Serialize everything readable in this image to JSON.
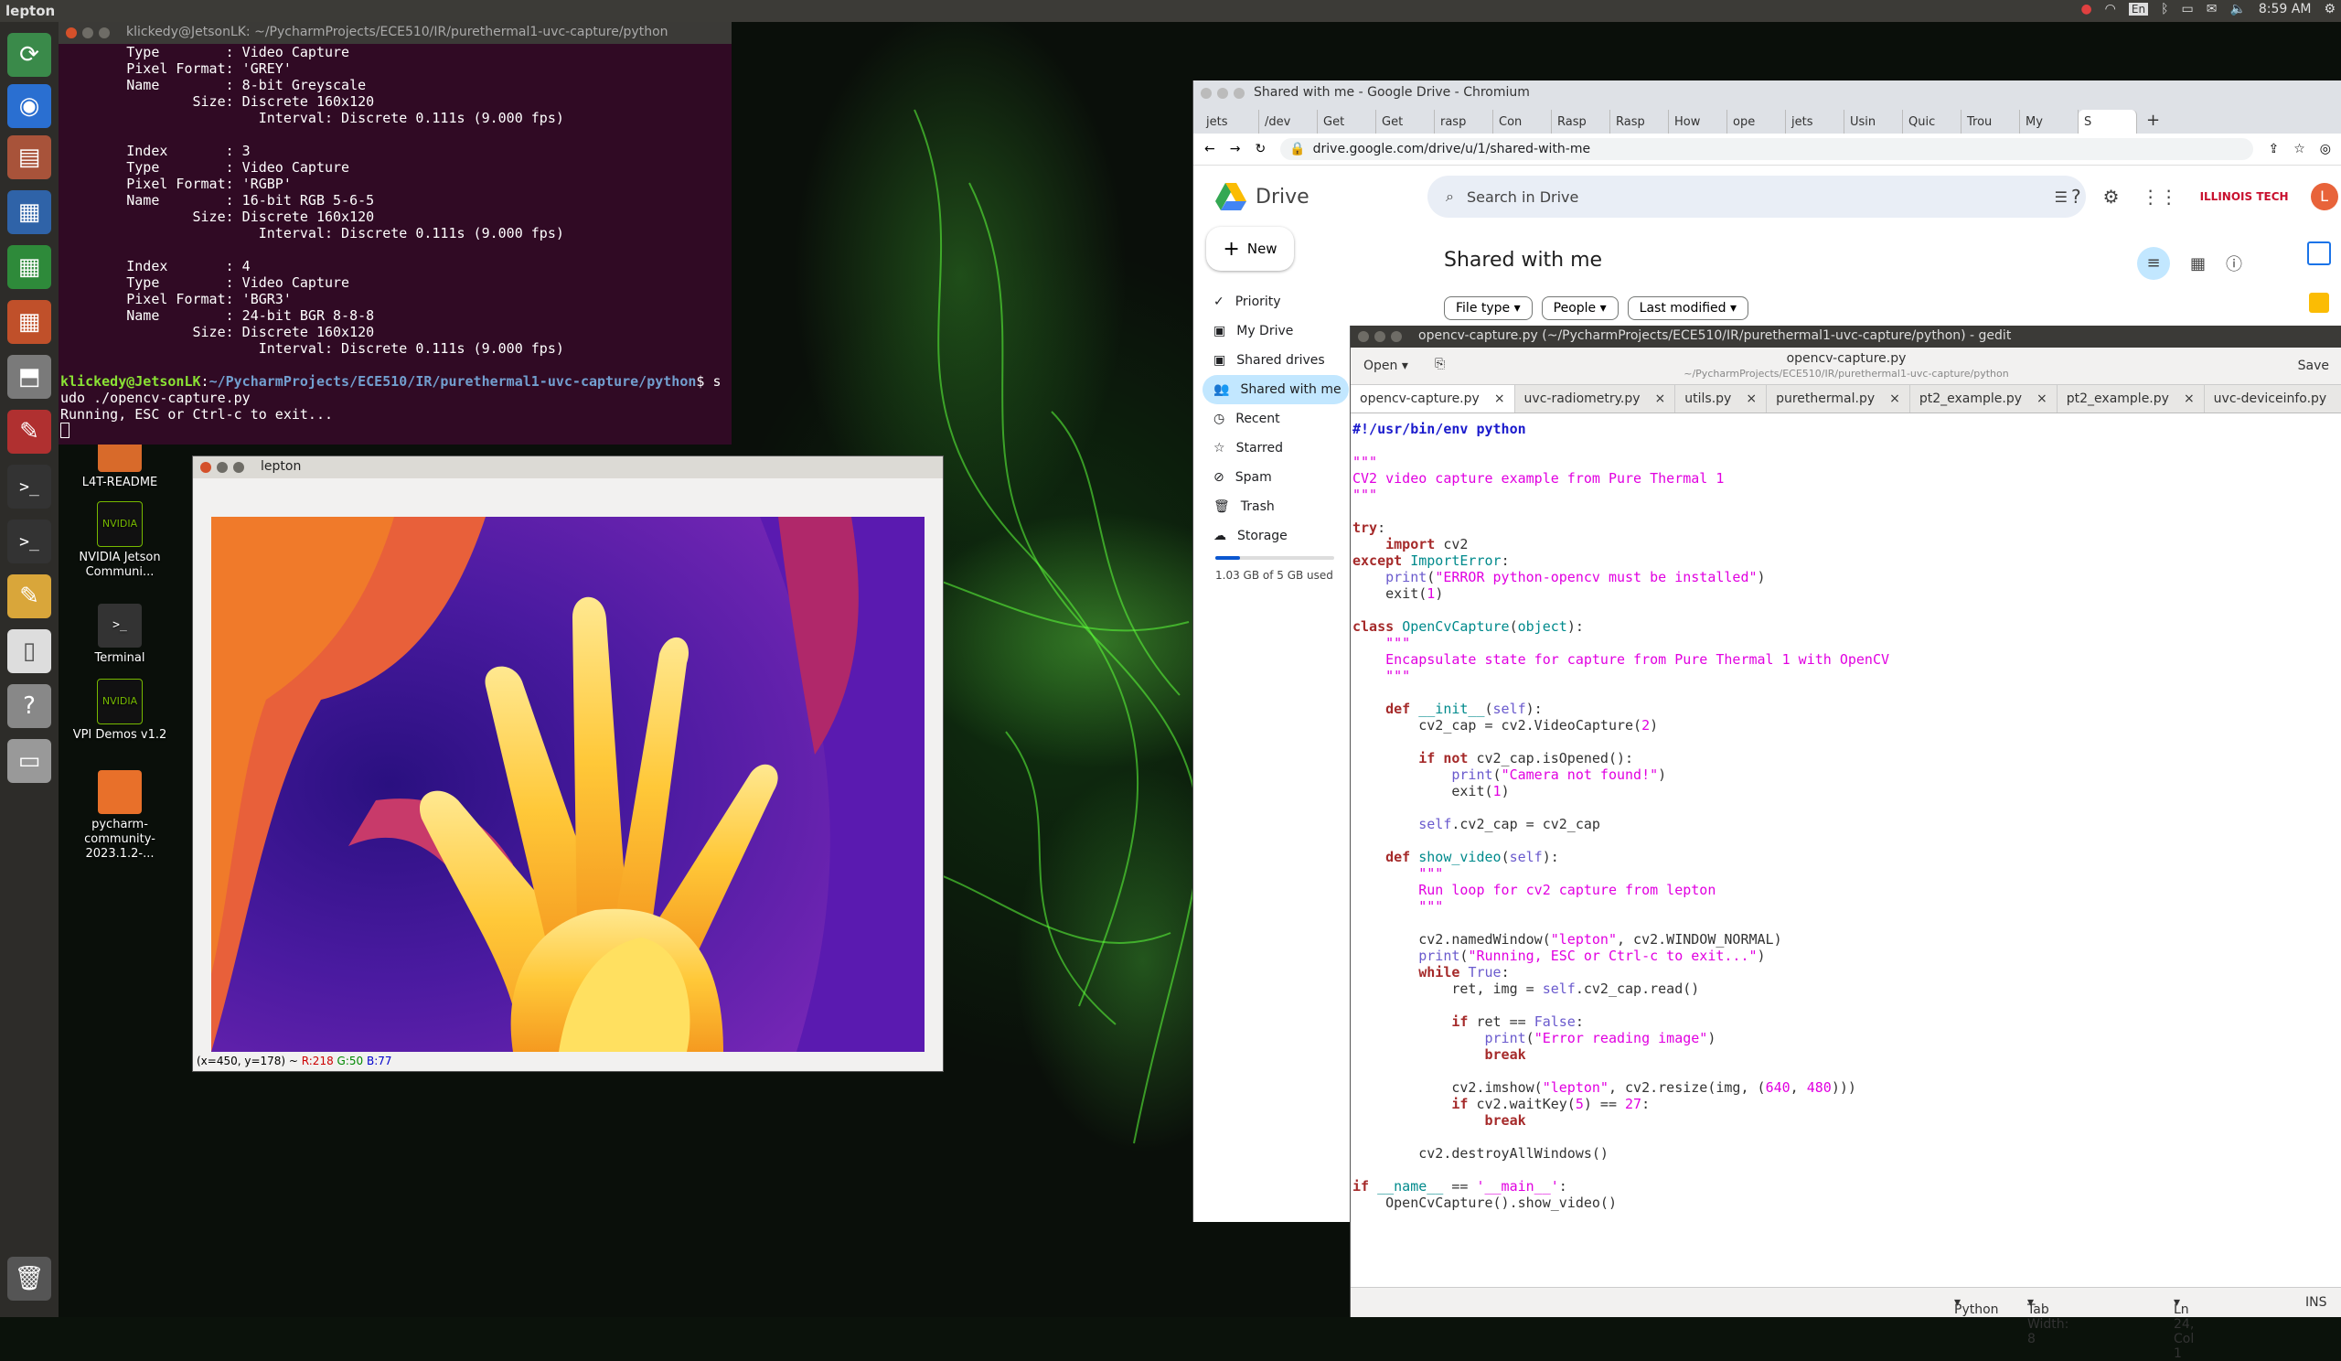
{
  "topbar": {
    "title": "lepton",
    "keyboard": "En",
    "clock": "8:59 AM"
  },
  "desktop_icons": [
    {
      "label": "L4T-README"
    },
    {
      "label": "NVIDIA Jetson Communi..."
    },
    {
      "label": "Terminal"
    },
    {
      "label": "VPI Demos v1.2"
    },
    {
      "label": "pycharm-community-2023.1.2-..."
    }
  ],
  "terminal": {
    "title": "klickedy@JetsonLK: ~/PycharmProjects/ECE510/IR/purethermal1-uvc-capture/python",
    "lines": [
      "        Type        : Video Capture",
      "        Pixel Format: 'GREY'",
      "        Name        : 8-bit Greyscale",
      "                Size: Discrete 160x120",
      "                        Interval: Discrete 0.111s (9.000 fps)",
      "",
      "        Index       : 3",
      "        Type        : Video Capture",
      "        Pixel Format: 'RGBP'",
      "        Name        : 16-bit RGB 5-6-5",
      "                Size: Discrete 160x120",
      "                        Interval: Discrete 0.111s (9.000 fps)",
      "",
      "        Index       : 4",
      "        Type        : Video Capture",
      "        Pixel Format: 'BGR3'",
      "        Name        : 24-bit BGR 8-8-8",
      "                Size: Discrete 160x120",
      "                        Interval: Discrete 0.111s (9.000 fps)",
      ""
    ],
    "prompt_user": "klickedy@JetsonLK",
    "prompt_path": "~/PycharmProjects/ECE510/IR/purethermal1-uvc-capture/python",
    "prompt_cmd": "$ s",
    "cmd_cont": "udo ./opencv-capture.py",
    "output": "Running, ESC or Ctrl-c to exit..."
  },
  "lepton": {
    "title": "lepton",
    "coord": "(x=450, y=178) ~ ",
    "r": "R:218",
    "g": "G:50",
    "b": "B:77"
  },
  "chrome": {
    "title": "Shared with me - Google Drive - Chromium",
    "tabs": [
      "jets",
      "/dev",
      "Get",
      "Get",
      "rasp",
      "Con",
      "Rasp",
      "Rasp",
      "How",
      "ope",
      "jets",
      "Usin",
      "Quic",
      "Trou",
      "My",
      "S"
    ],
    "url": "drive.google.com/drive/u/1/shared-with-me"
  },
  "drive": {
    "logo": "Drive",
    "search_placeholder": "Search in Drive",
    "org": "ILLINOIS TECH",
    "avatar": "L",
    "new_label": "New",
    "page_title": "Shared with me",
    "filters": [
      "File type",
      "People",
      "Last modified"
    ],
    "nav": [
      "Priority",
      "My Drive",
      "Shared drives",
      "Shared with me",
      "Recent",
      "Starred",
      "Spam",
      "Trash",
      "Storage"
    ],
    "storage_text": "1.03 GB of 5 GB used",
    "storage_used_fraction": 0.206
  },
  "gedit": {
    "title": "opencv-capture.py (~/PycharmProjects/ECE510/IR/purethermal1-uvc-capture/python) - gedit",
    "open_label": "Open",
    "file_label": "opencv-capture.py",
    "path_label": "~/PycharmProjects/ECE510/IR/purethermal1-uvc-capture/python",
    "save_label": "Save",
    "tabs": [
      "opencv-capture.py",
      "uvc-radiometry.py",
      "utils.py",
      "purethermal.py",
      "pt2_example.py",
      "pt2_example.py",
      "uvc-deviceinfo.py"
    ],
    "status_lang": "Python",
    "status_tab": "Tab Width: 8",
    "status_pos": "Ln 24, Col 1",
    "status_ins": "INS"
  }
}
